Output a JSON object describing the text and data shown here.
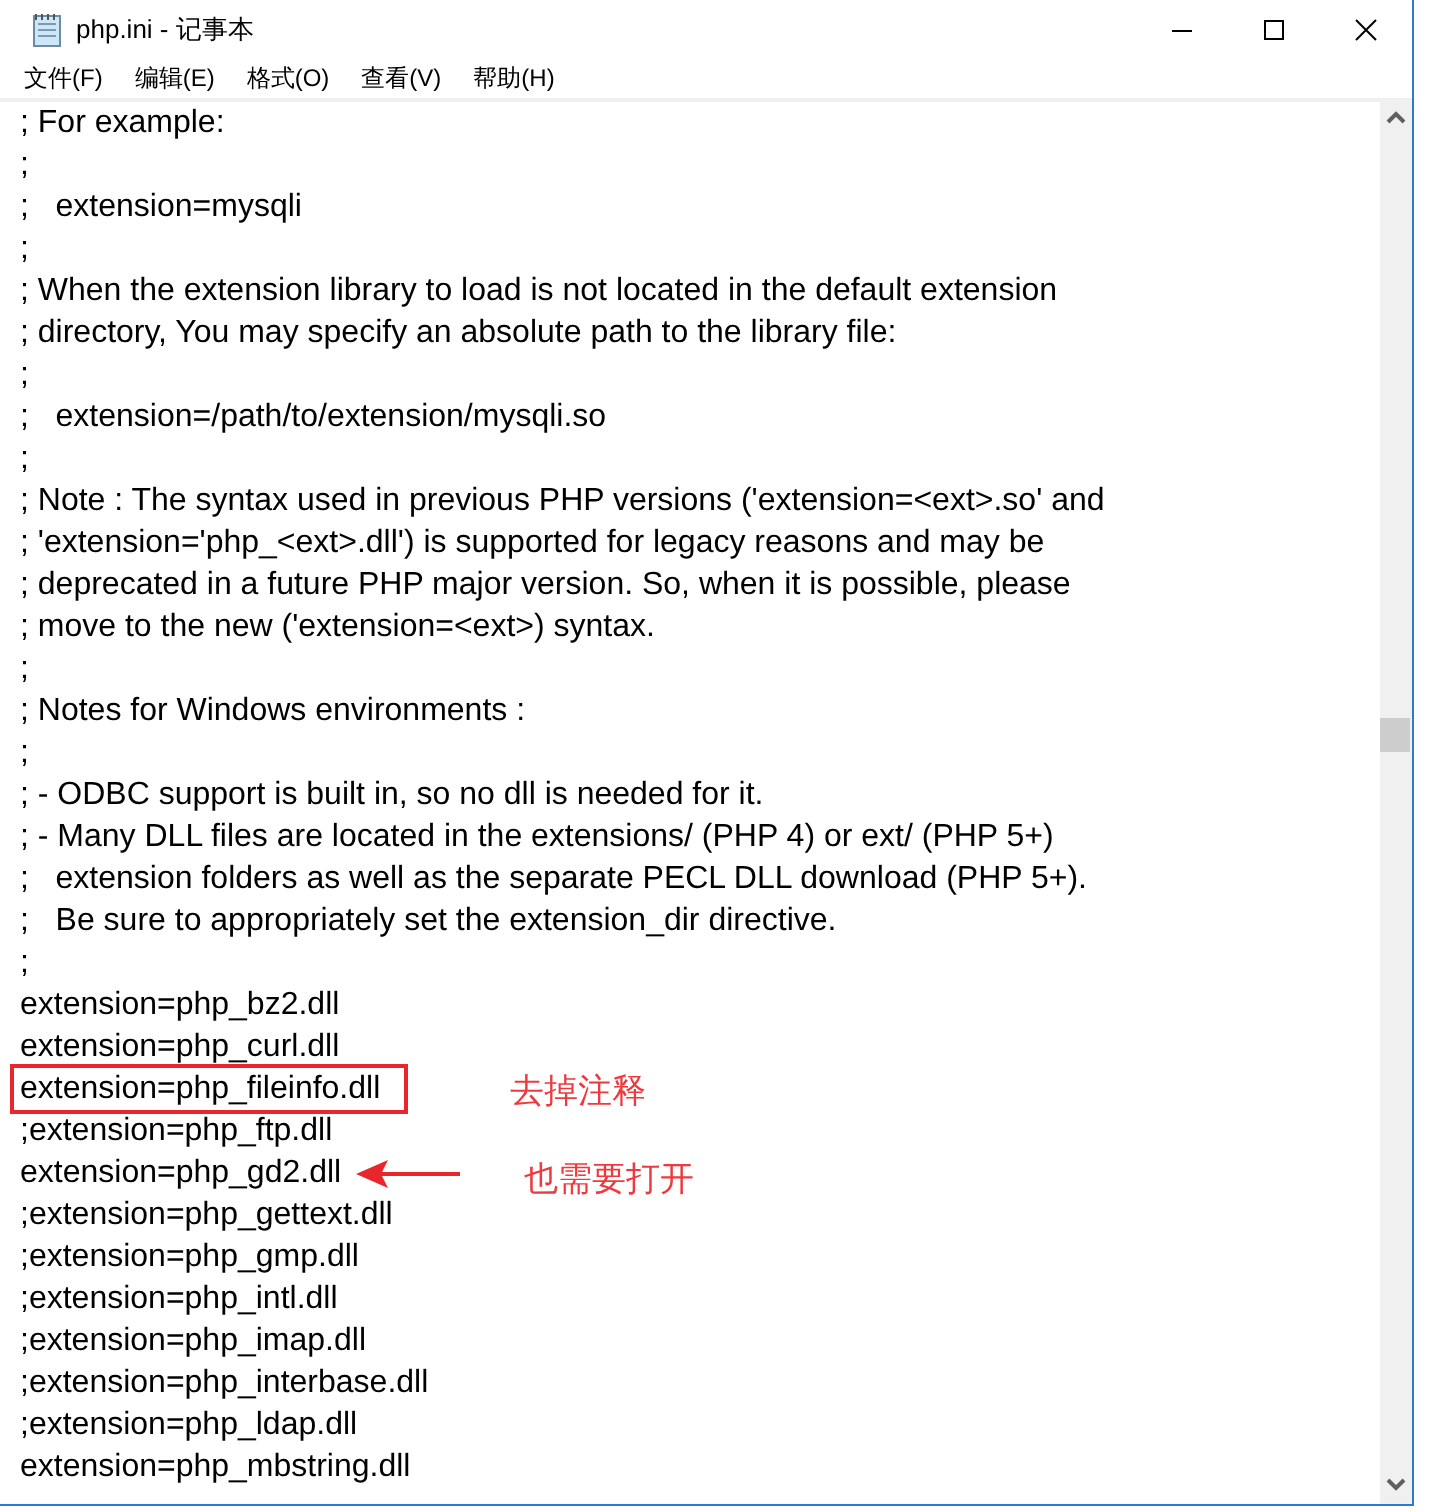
{
  "window": {
    "title": "php.ini - 记事本"
  },
  "menu": [
    {
      "label": "文件(F)"
    },
    {
      "label": "编辑(E)"
    },
    {
      "label": "格式(O)"
    },
    {
      "label": "查看(V)"
    },
    {
      "label": "帮助(H)"
    }
  ],
  "lines": [
    {
      "text": "; For example:"
    },
    {
      "text": ";"
    },
    {
      "text": ";   extension=mysqli"
    },
    {
      "text": ";"
    },
    {
      "text": "; When the extension library to load is not located in the default extension"
    },
    {
      "text": "; directory, You may specify an absolute path to the library file:"
    },
    {
      "text": ";"
    },
    {
      "text": ";   extension=/path/to/extension/mysqli.so"
    },
    {
      "text": ";"
    },
    {
      "text": "; Note : The syntax used in previous PHP versions ('extension=<ext>.so' and"
    },
    {
      "text": "; 'extension='php_<ext>.dll') is supported for legacy reasons and may be"
    },
    {
      "text": "; deprecated in a future PHP major version. So, when it is possible, please"
    },
    {
      "text": "; move to the new ('extension=<ext>) syntax."
    },
    {
      "text": ";"
    },
    {
      "text": "; Notes for Windows environments :"
    },
    {
      "text": ";"
    },
    {
      "text": "; - ODBC support is built in, so no dll is needed for it."
    },
    {
      "text": "; - Many DLL files are located in the extensions/ (PHP 4) or ext/ (PHP 5+)"
    },
    {
      "text": ";   extension folders as well as the separate PECL DLL download (PHP 5+)."
    },
    {
      "text": ";   Be sure to appropriately set the extension_dir directive."
    },
    {
      "text": ";"
    },
    {
      "text": "extension=php_bz2.dll"
    },
    {
      "text": "extension=php_curl.dll"
    },
    {
      "text": "extension=php_fileinfo.dll",
      "annotation": {
        "kind": "box",
        "note": "去掉注释"
      }
    },
    {
      "text": ";extension=php_ftp.dll"
    },
    {
      "text": "extension=php_gd2.dll",
      "annotation": {
        "kind": "arrow",
        "note": "也需要打开"
      }
    },
    {
      "text": ";extension=php_gettext.dll"
    },
    {
      "text": ";extension=php_gmp.dll"
    },
    {
      "text": ";extension=php_intl.dll"
    },
    {
      "text": ";extension=php_imap.dll"
    },
    {
      "text": ";extension=php_interbase.dll"
    },
    {
      "text": ";extension=php_ldap.dll"
    },
    {
      "text": "extension=php_mbstring.dll"
    }
  ]
}
